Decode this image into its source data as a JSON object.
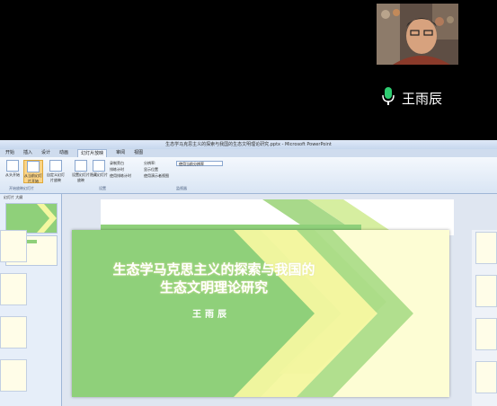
{
  "meeting": {
    "speaker_name": "王雨辰",
    "mic_icon": "microphone-icon",
    "accent": "#2ecc71"
  },
  "powerpoint": {
    "window_title": "生态学马克思主义的探索与我国的生态文明理论研究.pptx - Microsoft PowerPoint",
    "tabs": [
      "开始",
      "插入",
      "设计",
      "动画",
      "幻灯片放映",
      "审阅",
      "视图"
    ],
    "active_tab": "幻灯片放映",
    "ribbon": {
      "buttons": [
        {
          "label": "从头开始"
        },
        {
          "label": "从当前幻灯片开始"
        },
        {
          "label": "自定义幻灯片放映"
        },
        {
          "label": "设置幻灯片放映"
        },
        {
          "label": "隐藏幻灯片"
        }
      ],
      "options": [
        "录制旁白",
        "排练计时",
        "使用排练计时"
      ],
      "right_options": [
        "分辨率:",
        "显示位置",
        "使用演示者视图"
      ],
      "dropdown_value": "使用当前分辨率",
      "group_labels": [
        "开始放映幻灯片",
        "设置",
        "监视器"
      ]
    },
    "pane_tabs": [
      "幻灯片",
      "大纲"
    ]
  },
  "slide": {
    "title_line1": "生态学马克思主义的探索与我国的",
    "title_line2": "生态文明理论研究",
    "author": "王雨辰",
    "colors": {
      "background": "#fdfdd4",
      "green": "#8fd07a",
      "light_green": "#c9e98e",
      "yellow": "#f4f7a0"
    }
  }
}
